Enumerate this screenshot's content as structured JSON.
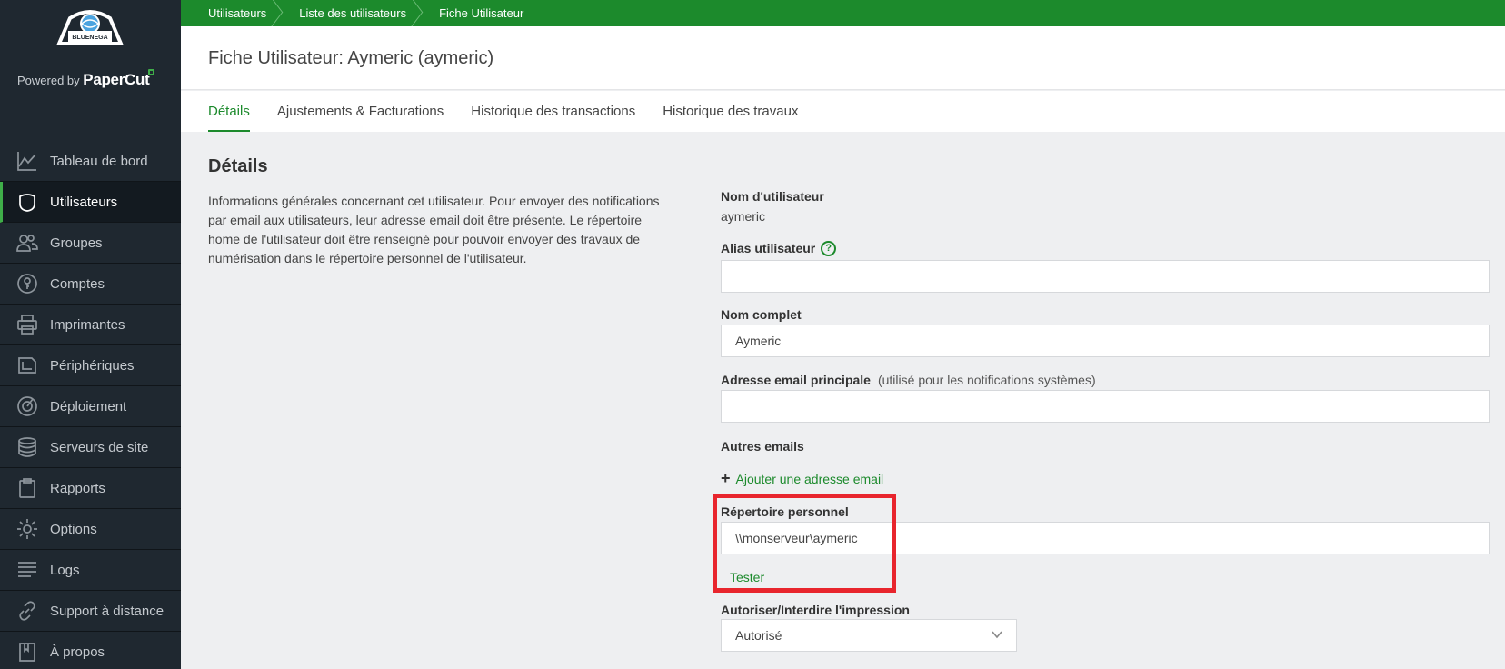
{
  "brand": {
    "logo_text": "BLUENEGA ACADEMY",
    "powered_by": "Powered by",
    "papercut": "PaperCut"
  },
  "sidebar": {
    "items": [
      {
        "label": "Tableau de bord",
        "icon": "chart-line-icon"
      },
      {
        "label": "Utilisateurs",
        "icon": "user-icon",
        "active": true
      },
      {
        "label": "Groupes",
        "icon": "users-icon"
      },
      {
        "label": "Comptes",
        "icon": "key-icon"
      },
      {
        "label": "Imprimantes",
        "icon": "printer-icon"
      },
      {
        "label": "Périphériques",
        "icon": "device-icon"
      },
      {
        "label": "Déploiement",
        "icon": "deploy-icon"
      },
      {
        "label": "Serveurs de site",
        "icon": "database-icon"
      },
      {
        "label": "Rapports",
        "icon": "clipboard-icon"
      },
      {
        "label": "Options",
        "icon": "gear-icon"
      },
      {
        "label": "Logs",
        "icon": "list-icon"
      },
      {
        "label": "Support à distance",
        "icon": "link-icon"
      },
      {
        "label": "À propos",
        "icon": "book-icon"
      }
    ]
  },
  "breadcrumb": [
    "Utilisateurs",
    "Liste des utilisateurs",
    "Fiche Utilisateur"
  ],
  "page_title": "Fiche Utilisateur: Aymeric (aymeric)",
  "tabs": [
    {
      "label": "Détails",
      "active": true
    },
    {
      "label": "Ajustements & Facturations"
    },
    {
      "label": "Historique des transactions"
    },
    {
      "label": "Historique des travaux"
    }
  ],
  "details": {
    "title": "Détails",
    "description": "Informations générales concernant cet utilisateur.  Pour envoyer des notifications par email aux utilisateurs, leur adresse email doit être présente. Le répertoire home de l'utilisateur doit être renseigné pour pouvoir envoyer des travaux de numérisation dans le répertoire personnel de l'utilisateur."
  },
  "form": {
    "username_label": "Nom d'utilisateur",
    "username_value": "aymeric",
    "alias_label": "Alias utilisateur",
    "alias_help": "?",
    "alias_value": "",
    "fullname_label": "Nom complet",
    "fullname_value": "Aymeric",
    "email_label": "Adresse email principale",
    "email_note": "(utilisé pour les notifications systèmes)",
    "email_value": "",
    "other_emails_label": "Autres emails",
    "add_email_plus": "+",
    "add_email_link": "Ajouter une adresse email",
    "home_dir_label": "Répertoire personnel",
    "home_dir_value": "\\\\monserveur\\aymeric",
    "test_link": "Tester",
    "print_label": "Autoriser/Interdire l'impression",
    "print_value": "Autorisé"
  },
  "colors": {
    "accent": "#1c8a2c",
    "sidebar_bg": "#1f2830",
    "highlight": "#e8252d"
  }
}
